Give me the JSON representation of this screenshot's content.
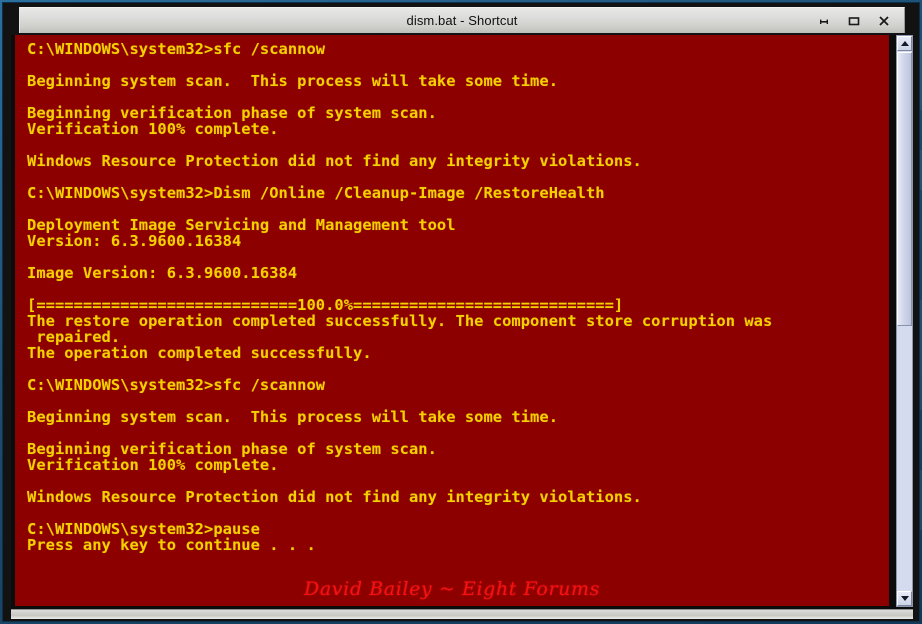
{
  "window": {
    "title": "dism.bat - Shortcut",
    "controls": [
      {
        "name": "minimize",
        "glyph": "–"
      },
      {
        "name": "maximize",
        "glyph": "▭"
      },
      {
        "name": "close",
        "glyph": "✕"
      }
    ]
  },
  "console": {
    "background_color": "#8c0000",
    "text_color": "#f4d000",
    "lines": [
      "C:\\WINDOWS\\system32>sfc /scannow",
      "",
      "Beginning system scan.  This process will take some time.",
      "",
      "Beginning verification phase of system scan.",
      "Verification 100% complete.",
      "",
      "Windows Resource Protection did not find any integrity violations.",
      "",
      "C:\\WINDOWS\\system32>Dism /Online /Cleanup-Image /RestoreHealth",
      "",
      "Deployment Image Servicing and Management tool",
      "Version: 6.3.9600.16384",
      "",
      "Image Version: 6.3.9600.16384",
      "",
      "[============================100.0%============================]",
      "The restore operation completed successfully. The component store corruption was",
      " repaired.",
      "The operation completed successfully.",
      "",
      "C:\\WINDOWS\\system32>sfc /scannow",
      "",
      "Beginning system scan.  This process will take some time.",
      "",
      "Beginning verification phase of system scan.",
      "Verification 100% complete.",
      "",
      "Windows Resource Protection did not find any integrity violations.",
      "",
      "C:\\WINDOWS\\system32>pause",
      "Press any key to continue . . ."
    ],
    "watermark": "David Bailey ~ Eight Forums",
    "watermark_color": "#ff1111"
  },
  "scrollbar": {
    "up_arrow": "▲",
    "down_arrow": "▼",
    "thumb_position_percent": 0,
    "thumb_size_percent": 51
  }
}
